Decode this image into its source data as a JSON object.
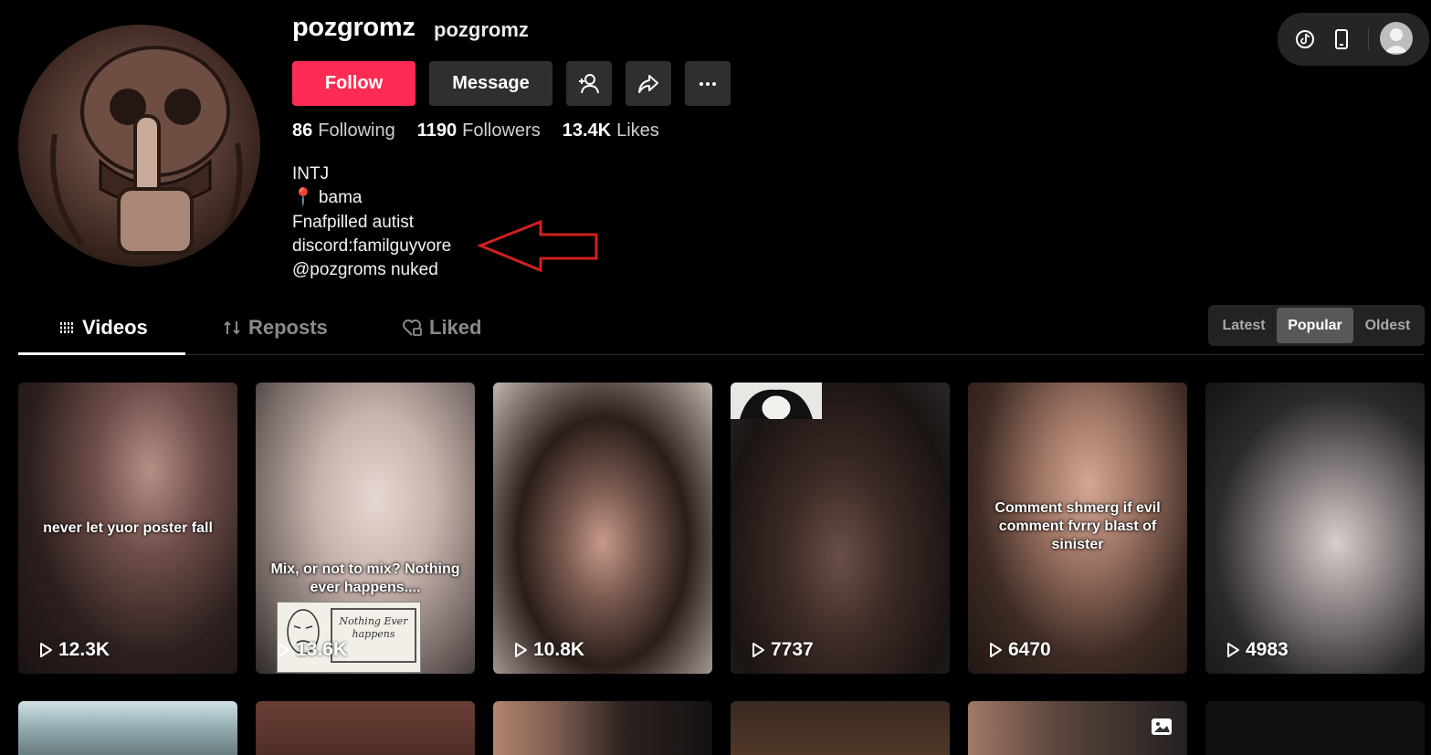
{
  "profile": {
    "username": "pozgromz",
    "nickname": "pozgromz",
    "follow_label": "Follow",
    "message_label": "Message",
    "stats": {
      "following_count": "86",
      "following_label": "Following",
      "followers_count": "1190",
      "followers_label": "Followers",
      "likes_count": "13.4K",
      "likes_label": "Likes"
    },
    "bio": [
      "INTJ",
      "📍 bama",
      "Fnafpilled autist",
      "discord:familguyvore",
      "@pozgroms nuked"
    ]
  },
  "tabs": {
    "videos": "Videos",
    "reposts": "Reposts",
    "liked": "Liked"
  },
  "sort": {
    "latest": "Latest",
    "popular": "Popular",
    "oldest": "Oldest",
    "selected": "Popular"
  },
  "videos": [
    {
      "caption": "never let yuor poster fall",
      "plays": "12.3K"
    },
    {
      "caption": "Mix, or not to mix? Nothing ever happens....",
      "plays": "13.6K",
      "sketch_text": "Nothing Ever happens"
    },
    {
      "caption": "",
      "plays": "10.8K"
    },
    {
      "caption": "",
      "plays": "7737"
    },
    {
      "caption": "Comment shmerg if evil comment fvrry blast of sinister",
      "plays": "6470"
    },
    {
      "caption": "",
      "plays": "4983"
    }
  ],
  "colors": {
    "background": "#000000",
    "follow": "#fe2c55",
    "secondary_button": "#2f2f2f",
    "annotation_arrow": "#d21f1f"
  },
  "icons": {
    "add_friend": "add-user-icon",
    "share": "share-icon",
    "more": "more-icon",
    "tiktok": "tiktok-icon",
    "device": "phone-icon",
    "videos_tab": "grid-icon",
    "reposts_tab": "repost-icon",
    "liked_tab": "heart-lock-icon",
    "play": "play-icon",
    "photo": "photo-icon"
  }
}
